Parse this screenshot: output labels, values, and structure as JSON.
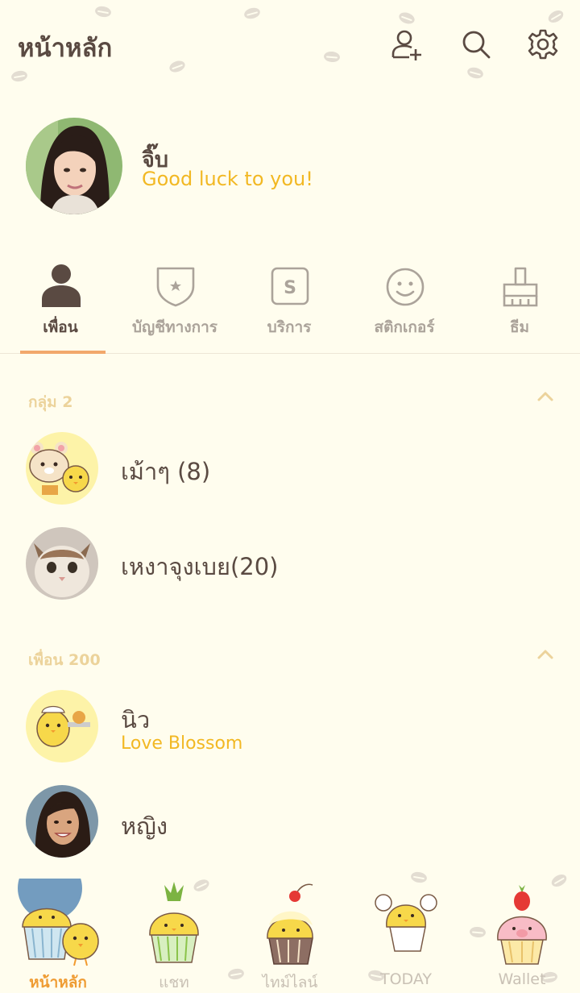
{
  "header": {
    "title": "หน้าหลัก",
    "icons": [
      "add-friend-icon",
      "search-icon",
      "settings-icon"
    ]
  },
  "profile": {
    "name": "จิ๊บ",
    "status": "Good luck to you!"
  },
  "tabs": [
    {
      "label": "เพื่อน",
      "icon": "person-icon",
      "active": true
    },
    {
      "label": "บัญชีทางการ",
      "icon": "shield-star-icon",
      "active": false
    },
    {
      "label": "บริการ",
      "icon": "service-s-icon",
      "active": false
    },
    {
      "label": "สติกเกอร์",
      "icon": "smiley-icon",
      "active": false
    },
    {
      "label": "ธีม",
      "icon": "brush-icon",
      "active": false
    }
  ],
  "groups_section": {
    "label": "กลุ่ม 2",
    "items": [
      {
        "name": "เม้าๆ (8)",
        "avatar": "bear-chick-group-avatar"
      },
      {
        "name": "เหงาจุงเบย(20)",
        "avatar": "cat-avatar"
      }
    ]
  },
  "friends_section": {
    "label": "เพื่อน 200",
    "items": [
      {
        "name": "นิว",
        "status": "Love Blossom",
        "avatar": "chick-avatar"
      },
      {
        "name": "หญิง",
        "status": "",
        "avatar": "woman-avatar"
      }
    ]
  },
  "bottom_nav": [
    {
      "label": "หน้าหลัก",
      "icon": "cupcake-chick-icon",
      "active": true
    },
    {
      "label": "แชท",
      "icon": "pineapple-cupcake-icon",
      "active": false
    },
    {
      "label": "ไทม์ไลน์",
      "icon": "cherry-cupcake-icon",
      "active": false
    },
    {
      "label": "TODAY",
      "icon": "cupcake-earmuffs-icon",
      "active": false
    },
    {
      "label": "Wallet",
      "icon": "strawberry-cupcake-icon",
      "active": false
    }
  ],
  "colors": {
    "background": "#fffdee",
    "text_dark": "#5a4a42",
    "accent_yellow": "#f2b823",
    "accent_orange": "#ef9c33",
    "tab_underline": "#f2a86c",
    "muted": "#aba39a"
  }
}
